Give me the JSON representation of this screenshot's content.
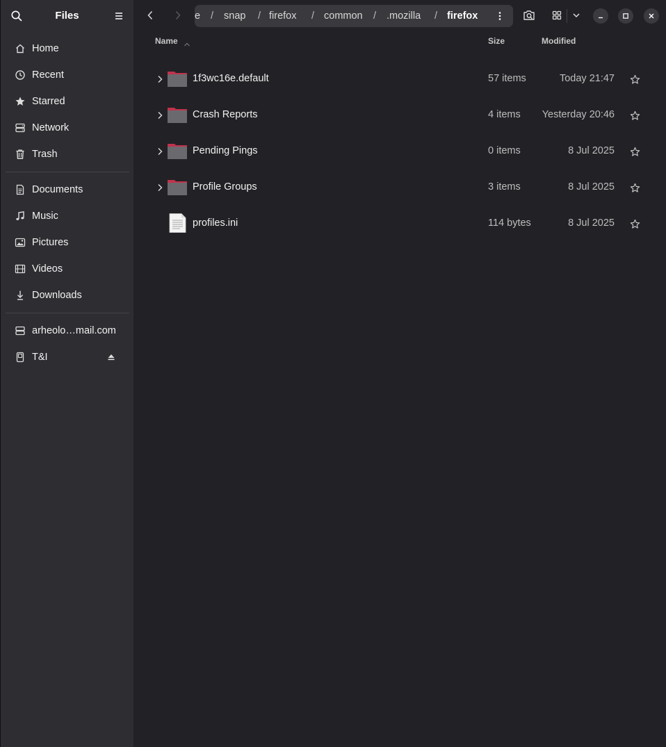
{
  "sidebar": {
    "title": "Files",
    "places": [
      {
        "label": "Home",
        "icon": "home-icon"
      },
      {
        "label": "Recent",
        "icon": "clock-icon"
      },
      {
        "label": "Starred",
        "icon": "star-icon"
      },
      {
        "label": "Network",
        "icon": "network-icon"
      },
      {
        "label": "Trash",
        "icon": "trash-icon"
      }
    ],
    "bookmarks": [
      {
        "label": "Documents",
        "icon": "document-icon"
      },
      {
        "label": "Music",
        "icon": "music-icon"
      },
      {
        "label": "Pictures",
        "icon": "picture-icon"
      },
      {
        "label": "Videos",
        "icon": "video-icon"
      },
      {
        "label": "Downloads",
        "icon": "download-icon"
      }
    ],
    "devices": [
      {
        "label": "arheolo…mail.com",
        "icon": "drive-icon"
      },
      {
        "label": "T&I",
        "icon": "removable-drive-icon"
      }
    ]
  },
  "pathbar": {
    "crumbs": [
      "e",
      "snap",
      "firefox",
      "common",
      ".mozilla",
      "firefox"
    ],
    "separator": "/"
  },
  "columns": {
    "name": "Name",
    "size": "Size",
    "modified": "Modified"
  },
  "files": [
    {
      "name": "1f3wc16e.default",
      "size": "57 items",
      "modified": "Today 21:47",
      "type": "folder"
    },
    {
      "name": "Crash Reports",
      "size": "4 items",
      "modified": "Yesterday 20:46",
      "type": "folder"
    },
    {
      "name": "Pending Pings",
      "size": "0 items",
      "modified": "8 Jul 2025",
      "type": "folder"
    },
    {
      "name": "Profile Groups",
      "size": "3 items",
      "modified": "8 Jul 2025",
      "type": "folder"
    },
    {
      "name": "profiles.ini",
      "size": "114 bytes",
      "modified": "8 Jul 2025",
      "type": "file"
    }
  ],
  "colors": {
    "background": "#222226",
    "sidebar": "#2e2e32",
    "folder_tab": "#c0334d",
    "folder_body": "#6a6a6e"
  }
}
